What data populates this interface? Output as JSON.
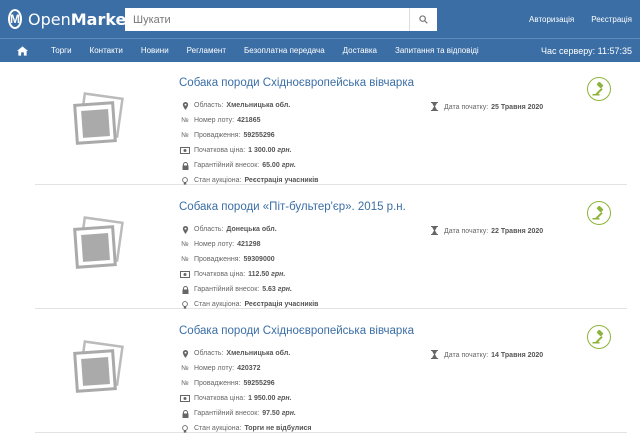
{
  "header": {
    "logo_text_a": "Open",
    "logo_text_b": "Market",
    "logo_mark": "M",
    "search_placeholder": "Шукати",
    "login_label": "Авторизація",
    "register_label": "Реєстрація"
  },
  "nav": {
    "items": [
      "Торги",
      "Контакти",
      "Новини",
      "Регламент",
      "Безоплатна передача",
      "Доставка",
      "Запитання та відповіді"
    ],
    "server_time_label": "Час серверу:",
    "server_time": "11:57:35"
  },
  "labels": {
    "region": "Область:",
    "lot_number": "Номер лоту:",
    "proceeding": "Провадження:",
    "start_price": "Початкова ціна:",
    "guarantee": "Гарантійний внесок:",
    "auction_state": "Стан аукціона:",
    "start_date": "Дата початку:",
    "currency": "грн."
  },
  "lots": [
    {
      "title": "Собака породи Східноєвропейська вівчарка",
      "region": "Хмельницька обл.",
      "lot_number": "421865",
      "proceeding": "59255296",
      "start_price": "1 300.00",
      "guarantee": "65.00",
      "state": "Реєстрація учасників",
      "start_date": "25 Травня 2020"
    },
    {
      "title": "Собака породи «Піт-бультер'єр». 2015 р.н.",
      "region": "Донецька обл.",
      "lot_number": "421298",
      "proceeding": "59309000",
      "start_price": "112.50",
      "guarantee": "5.63",
      "state": "Реєстрація учасників",
      "start_date": "22 Травня 2020"
    },
    {
      "title": "Собака породи Східноєвропейська вівчарка",
      "region": "Хмельницька обл.",
      "lot_number": "420372",
      "proceeding": "59255296",
      "start_price": "1 950.00",
      "guarantee": "97.50",
      "state": "Торги не відбулися",
      "start_date": "14 Травня 2020"
    }
  ],
  "colors": {
    "primary": "#3b6ea5",
    "gavel": "#8db33a"
  },
  "icons": [
    "search-icon",
    "home-icon",
    "pin-icon",
    "number-icon",
    "money-icon",
    "lock-icon",
    "bulb-icon",
    "hourglass-icon",
    "gavel-icon",
    "image-placeholder-icon"
  ]
}
